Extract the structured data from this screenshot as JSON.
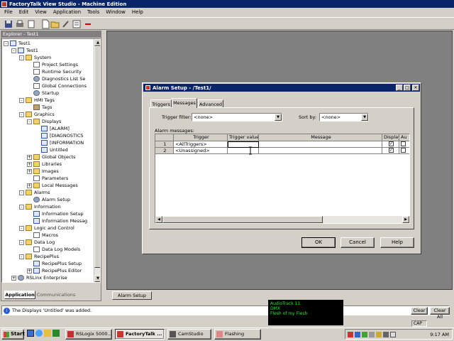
{
  "window": {
    "title": "FactoryTalk View Studio - Machine Edition"
  },
  "menu": [
    "File",
    "Edit",
    "View",
    "Application",
    "Tools",
    "Window",
    "Help"
  ],
  "explorer": {
    "title": "Explorer - Test1",
    "tree": [
      {
        "label": "Test1",
        "level": 1,
        "icon": "app-icon",
        "exp": "-"
      },
      {
        "label": "Test1",
        "level": 2,
        "icon": "app-icon",
        "exp": "-"
      },
      {
        "label": "System",
        "level": 3,
        "icon": "folder",
        "exp": "-"
      },
      {
        "label": "Project Settings",
        "level": 4,
        "icon": "doc",
        "exp": ""
      },
      {
        "label": "Runtime Security",
        "level": 4,
        "icon": "doc",
        "exp": ""
      },
      {
        "label": "Diagnostics List Se",
        "level": 4,
        "icon": "gear",
        "exp": ""
      },
      {
        "label": "Global Connections",
        "level": 4,
        "icon": "doc",
        "exp": ""
      },
      {
        "label": "Startup",
        "level": 4,
        "icon": "gear",
        "exp": ""
      },
      {
        "label": "HMI Tags",
        "level": 3,
        "icon": "folder",
        "exp": "-"
      },
      {
        "label": "Tags",
        "level": 4,
        "icon": "tag",
        "exp": ""
      },
      {
        "label": "Graphics",
        "level": 3,
        "icon": "folder",
        "exp": "-"
      },
      {
        "label": "Displays",
        "level": 4,
        "icon": "folder",
        "exp": "-"
      },
      {
        "label": "[ALARM]",
        "level": 5,
        "icon": "disp",
        "exp": ""
      },
      {
        "label": "[DIAGNOSTICS",
        "level": 5,
        "icon": "disp",
        "exp": ""
      },
      {
        "label": "[INFORMATION",
        "level": 5,
        "icon": "disp",
        "exp": ""
      },
      {
        "label": "Untitled",
        "level": 5,
        "icon": "disp",
        "exp": ""
      },
      {
        "label": "Global Objects",
        "level": 4,
        "icon": "folder",
        "exp": "+"
      },
      {
        "label": "Libraries",
        "level": 4,
        "icon": "folder",
        "exp": "+"
      },
      {
        "label": "Images",
        "level": 4,
        "icon": "folder",
        "exp": "+"
      },
      {
        "label": "Parameters",
        "level": 4,
        "icon": "doc",
        "exp": ""
      },
      {
        "label": "Local Messages",
        "level": 4,
        "icon": "folder",
        "exp": "+"
      },
      {
        "label": "Alarms",
        "level": 3,
        "icon": "folder",
        "exp": "-"
      },
      {
        "label": "Alarm Setup",
        "level": 4,
        "icon": "gear",
        "exp": ""
      },
      {
        "label": "Information",
        "level": 3,
        "icon": "folder",
        "exp": "-"
      },
      {
        "label": "Information Setup",
        "level": 4,
        "icon": "disp",
        "exp": ""
      },
      {
        "label": "Information Messag",
        "level": 4,
        "icon": "disp",
        "exp": ""
      },
      {
        "label": "Logic and Control",
        "level": 3,
        "icon": "folder",
        "exp": "-"
      },
      {
        "label": "Macros",
        "level": 4,
        "icon": "doc",
        "exp": ""
      },
      {
        "label": "Data Log",
        "level": 3,
        "icon": "folder",
        "exp": "-"
      },
      {
        "label": "Data Log Models",
        "level": 4,
        "icon": "doc",
        "exp": ""
      },
      {
        "label": "RecipePlus",
        "level": 3,
        "icon": "folder",
        "exp": "-"
      },
      {
        "label": "RecipePlus Setup",
        "level": 4,
        "icon": "disp",
        "exp": ""
      },
      {
        "label": "RecipePlus Editor",
        "level": 4,
        "icon": "disp",
        "exp": "+"
      },
      {
        "label": "RSLinx Enterprise",
        "level": 2,
        "icon": "gear",
        "exp": "+"
      }
    ],
    "tabs": [
      "Application",
      "Communications"
    ]
  },
  "dialog": {
    "title": "Alarm Setup - /Test1/",
    "tabs": [
      "Triggers",
      "Messages",
      "Advanced"
    ],
    "trigger_filter_label": "Trigger filter:",
    "trigger_filter_value": "<none>",
    "sort_by_label": "Sort by:",
    "sort_by_value": "<none>",
    "alarm_messages_label": "Alarm messages:",
    "columns": [
      "Trigger",
      "Trigger value",
      "Message",
      "Display",
      "Au"
    ],
    "rows": [
      {
        "num": "1",
        "trigger": "<AllTriggers>",
        "value": "",
        "message": "",
        "display": true
      },
      {
        "num": "2",
        "trigger": "<Unassigned>",
        "value": "",
        "message": "",
        "display": true
      }
    ],
    "ok": "OK",
    "cancel": "Cancel",
    "help": "Help"
  },
  "mdi_task": "Alarm Setup",
  "status": {
    "message": "The Displays 'Untitled' was added.",
    "clear": "Clear",
    "clear_all": "Clear All",
    "cap": "CAP"
  },
  "overlay": {
    "line1": "AudioTrack 11",
    "line2": "DMX",
    "line3": "Flesh of my Flesh"
  },
  "taskbar": {
    "start": "Start",
    "items": [
      "RSLogix 5000...",
      "FactoryTalk ...",
      "CamStudio",
      "Flashing"
    ],
    "clock": "9:17 AM"
  }
}
